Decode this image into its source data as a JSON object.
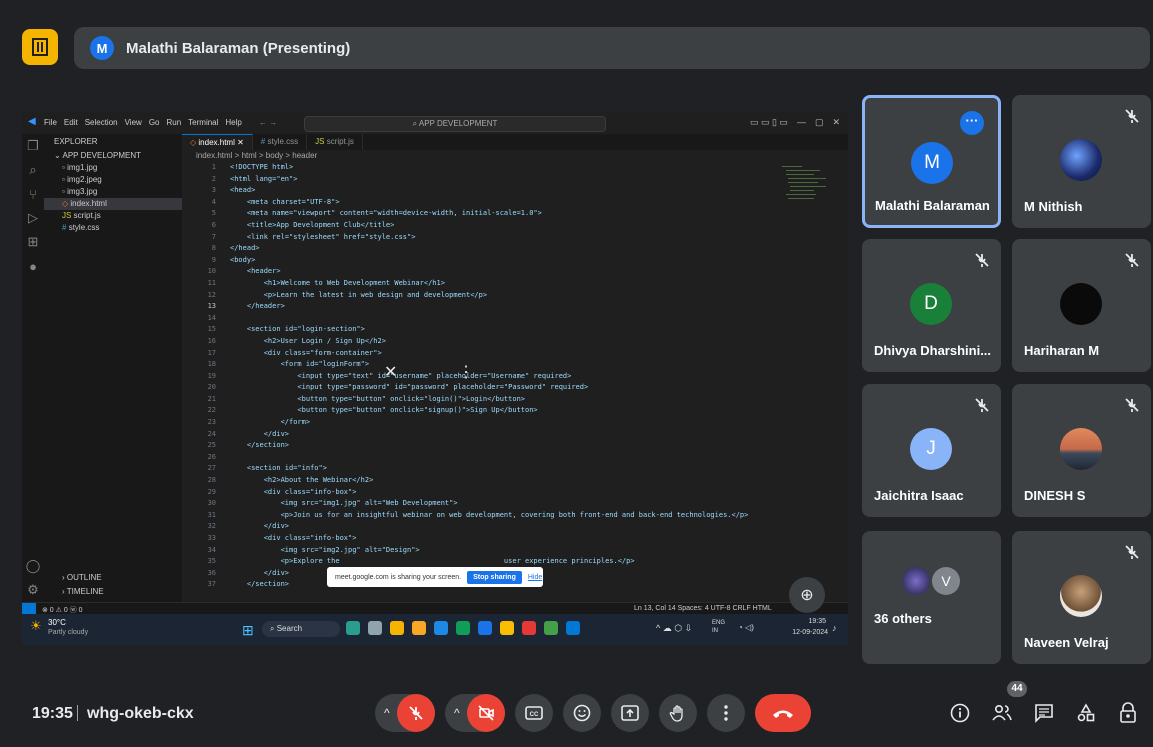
{
  "top": {
    "presenter_initial": "M",
    "presenter_label": "Malathi Balaraman (Presenting)"
  },
  "vscode": {
    "menu": [
      "File",
      "Edit",
      "Selection",
      "View",
      "Go",
      "Run",
      "Terminal",
      "Help"
    ],
    "search": "APP DEVELOPMENT",
    "explorer_title": "EXPLORER",
    "folder": "APP DEVELOPMENT",
    "files": [
      "img1.jpg",
      "img2.jpeg",
      "img3.jpg",
      "index.html",
      "script.js",
      "style.css"
    ],
    "outline": "OUTLINE",
    "timeline": "TIMELINE",
    "tabs": [
      "index.html",
      "style.css",
      "script.js"
    ],
    "breadcrumb": "index.html > html > body > header",
    "lines": [
      "<!DOCTYPE html>",
      "<html lang=\"en\">",
      "<head>",
      "    <meta charset=\"UTF-8\">",
      "    <meta name=\"viewport\" content=\"width=device-width, initial-scale=1.0\">",
      "    <title>App Development Club</title>",
      "    <link rel=\"stylesheet\" href=\"style.css\">",
      "</head>",
      "<body>",
      "    <header>",
      "        <h1>Welcome to Web Development Webinar</h1>",
      "        <p>Learn the latest in web design and development</p>",
      "    </header>",
      "",
      "    <section id=\"login-section\">",
      "        <h2>User Login / Sign Up</h2>",
      "        <div class=\"form-container\">",
      "            <form id=\"loginForm\">",
      "                <input type=\"text\" id=\"username\" placeholder=\"Username\" required>",
      "                <input type=\"password\" id=\"password\" placeholder=\"Password\" required>",
      "                <button type=\"button\" onclick=\"login()\">Login</button>",
      "                <button type=\"button\" onclick=\"signup()\">Sign Up</button>",
      "            </form>",
      "        </div>",
      "    </section>",
      "",
      "    <section id=\"info\">",
      "        <h2>About the Webinar</h2>",
      "        <div class=\"info-box\">",
      "            <img src=\"img1.jpg\" alt=\"Web Development\">",
      "            <p>Join us for an insightful webinar on web development, covering both front-end and back-end technologies.</p>",
      "        </div>",
      "        <div class=\"info-box\">",
      "            <img src=\"img2.jpg\" alt=\"Design\">",
      "            <p>Explore the                                       user experience principles.</p>",
      "        </div>",
      "    </section>"
    ],
    "status_left": "⊗ 0 ⚠ 0  ⓦ 0",
    "status_right": "Ln 13, Col 14   Spaces: 4   UTF-8   CRLF   HTML",
    "weather_temp": "30°C",
    "weather_desc": "Partly cloudy",
    "taskbar_search": "Search",
    "tray_lang": "ENG\nIN",
    "tray_time": "19:35",
    "tray_date": "12-09-2024",
    "share_text": "meet.google.com is sharing your screen.",
    "stop_label": "Stop sharing",
    "hide_label": "Hide"
  },
  "tiles": [
    {
      "name": "Malathi Balaraman",
      "initial": "M",
      "color": "#1a73e8"
    },
    {
      "name": "M Nithish"
    },
    {
      "name": "Dhivya Dharshini...",
      "initial": "D",
      "color": "#188038"
    },
    {
      "name": "Hariharan M"
    },
    {
      "name": "Jaichitra Isaac",
      "initial": "J",
      "color": "#8ab4f8"
    },
    {
      "name": "DINESH S"
    },
    {
      "name": "36 others",
      "initial": "V"
    },
    {
      "name": "Naveen Velraj"
    }
  ],
  "bottom": {
    "time": "19:35",
    "meeting_code": "whg-okeb-ckx",
    "participants_count": "44"
  }
}
